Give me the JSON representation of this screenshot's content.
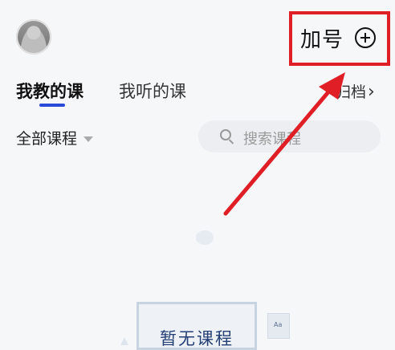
{
  "header": {
    "add_label": "加号"
  },
  "tabs": [
    {
      "label": "我教的课",
      "active": true
    },
    {
      "label": "我听的课",
      "active": false
    }
  ],
  "archive": {
    "label": "归档",
    "chevron": "›"
  },
  "filter": {
    "label": "全部课程"
  },
  "search": {
    "placeholder": "搜索课程"
  },
  "empty_state": {
    "message": "暂无课程",
    "mini_label": "Aa"
  },
  "colors": {
    "accent": "#2a4bd7",
    "annotation_red": "#e01e26",
    "background": "#f6f7f9"
  },
  "icons": [
    "avatar",
    "add-circle-icon",
    "chevron-right-icon",
    "caret-down-icon",
    "search-icon"
  ]
}
